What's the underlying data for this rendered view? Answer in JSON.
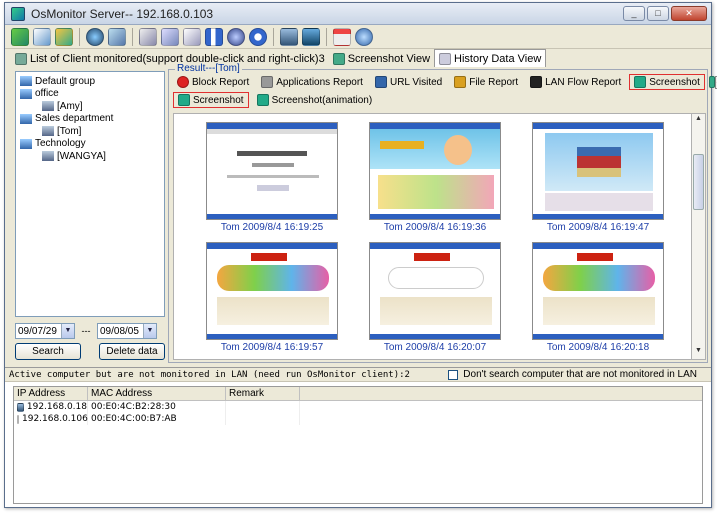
{
  "window": {
    "title": "OsMonitor Server-- 192.168.0.103",
    "controls": {
      "minimize": "_",
      "maximize": "□",
      "close": "✕"
    }
  },
  "toolbar_icons": [
    "clients-icon",
    "report-icon",
    "users-icon",
    "refresh-icon",
    "globe-icon",
    "screenshot-icon",
    "copy-icon",
    "capture-icon",
    "pause-icon",
    "settings-icon",
    "info-icon",
    "monitor-icon",
    "lock-icon",
    "window-icon",
    "help-icon"
  ],
  "top_tabs": [
    {
      "label": "List of Client monitored(support double-click and right-click)3",
      "icon": "clients-icon"
    },
    {
      "label": "Screenshot View",
      "icon": "screenshot-icon"
    },
    {
      "label": "History Data View",
      "icon": "history-icon"
    }
  ],
  "tree": [
    {
      "label": "Default group",
      "level": 0,
      "icon": "group-icon"
    },
    {
      "label": "office",
      "level": 0,
      "icon": "group-icon"
    },
    {
      "label": "[Amy]",
      "level": 1,
      "icon": "computer-icon"
    },
    {
      "label": "Sales department",
      "level": 0,
      "icon": "group-icon"
    },
    {
      "label": "[Tom]",
      "level": 1,
      "icon": "computer-icon"
    },
    {
      "label": "Technology",
      "level": 0,
      "icon": "group-icon"
    },
    {
      "label": "[WANGYA]",
      "level": 1,
      "icon": "computer-icon"
    }
  ],
  "date_range": {
    "from": "09/07/29",
    "separator": "---",
    "to": "09/08/05"
  },
  "buttons": {
    "search": "Search",
    "delete": "Delete data"
  },
  "result": {
    "title": "Result---[Tom]",
    "report_tabs": [
      {
        "label": "Block Report",
        "icon": "block-icon",
        "color": "#d22"
      },
      {
        "label": "Applications Report",
        "icon": "apps-icon",
        "color": "#777"
      },
      {
        "label": "URL Visited",
        "icon": "url-icon",
        "color": "#36a"
      },
      {
        "label": "File Report",
        "icon": "file-icon",
        "color": "#d9a020"
      },
      {
        "label": "LAN Flow Report",
        "icon": "flow-icon",
        "color": "#222"
      },
      {
        "label": "Screenshot",
        "icon": "screenshot-icon",
        "color": "#2a8"
      }
    ],
    "sub_tabs": [
      {
        "label": "Screenshot",
        "icon": "screenshot-icon"
      },
      {
        "label": "Screenshot(animation)",
        "icon": "animation-icon"
      }
    ],
    "shots": [
      {
        "caption": "Tom 2009/8/4 16:19:25"
      },
      {
        "caption": "Tom 2009/8/4 16:19:36"
      },
      {
        "caption": "Tom 2009/8/4 16:19:47"
      },
      {
        "caption": "Tom 2009/8/4 16:19:57"
      },
      {
        "caption": "Tom 2009/8/4 16:20:07"
      },
      {
        "caption": "Tom 2009/8/4 16:20:18"
      }
    ]
  },
  "lan": {
    "header": "Active computer but are not monitored in LAN (need run OsMonitor client):2",
    "checkbox_label": "Don't search computer that are not monitored in LAN",
    "columns": [
      "IP Address",
      "MAC Address",
      "Remark"
    ],
    "rows": [
      {
        "ip": "192.168.0.18",
        "mac": "00:E0:4C:B2:28:30",
        "remark": ""
      },
      {
        "ip": "192.168.0.106",
        "mac": "00:E0:4C:00:B7:AB",
        "remark": ""
      }
    ]
  }
}
